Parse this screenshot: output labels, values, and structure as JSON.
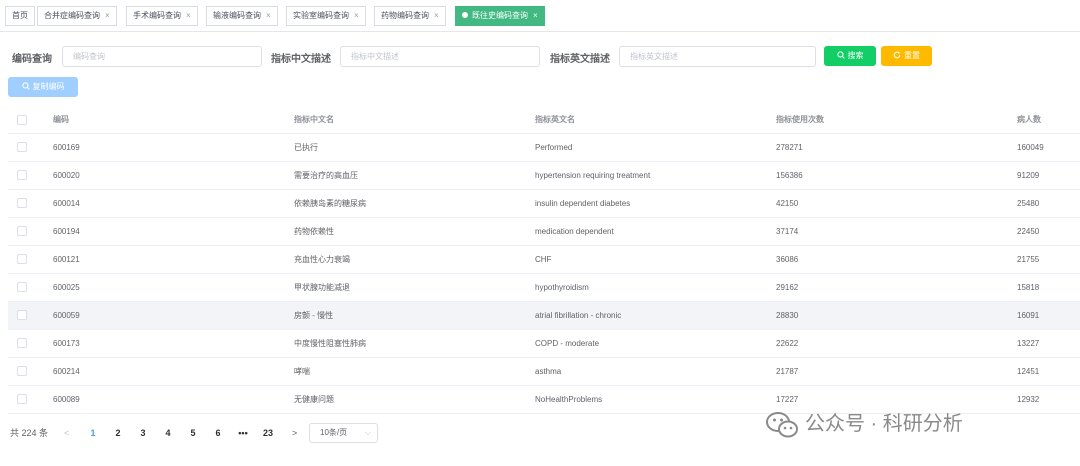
{
  "tags": [
    {
      "label": "首页",
      "closable": false,
      "active": false
    },
    {
      "label": "合并症编码查询",
      "closable": true,
      "active": false
    },
    {
      "label": "手术编码查询",
      "closable": true,
      "active": false
    },
    {
      "label": "输液编码查询",
      "closable": true,
      "active": false
    },
    {
      "label": "实验室编码查询",
      "closable": true,
      "active": false
    },
    {
      "label": "药物编码查询",
      "closable": true,
      "active": false
    },
    {
      "label": "既往史编码查询",
      "closable": true,
      "active": true
    }
  ],
  "close_glyph": "×",
  "filters": {
    "code_label": "编码查询",
    "code_placeholder": "编码查询",
    "cn_label": "指标中文描述",
    "cn_placeholder": "指标中文描述",
    "en_label": "指标英文描述",
    "en_placeholder": "指标英文描述"
  },
  "buttons": {
    "search": "搜索",
    "reset": "重置",
    "copy": "复制编码"
  },
  "table": {
    "columns": [
      "编码",
      "指标中文名",
      "指标英文名",
      "指标使用次数",
      "病人数"
    ],
    "rows": [
      [
        "600169",
        "已执行",
        "Performed",
        "278271",
        "160049"
      ],
      [
        "600020",
        "需要治疗的高血压",
        "hypertension requiring treatment",
        "156386",
        "91209"
      ],
      [
        "600014",
        "依赖胰岛素的糖尿病",
        "insulin dependent diabetes",
        "42150",
        "25480"
      ],
      [
        "600194",
        "药物依赖性",
        "medication dependent",
        "37174",
        "22450"
      ],
      [
        "600121",
        "充血性心力衰竭",
        "CHF",
        "36086",
        "21755"
      ],
      [
        "600025",
        "甲状腺功能减退",
        "hypothyroidism",
        "29162",
        "15818"
      ],
      [
        "600059",
        "房颤 - 慢性",
        "atrial fibrillation - chronic",
        "28830",
        "16091"
      ],
      [
        "600173",
        "中度慢性阻塞性肺病",
        "COPD - moderate",
        "22622",
        "13227"
      ],
      [
        "600214",
        "哮喘",
        "asthma",
        "21787",
        "12451"
      ],
      [
        "600089",
        "无健康问题",
        "NoHealthProblems",
        "17227",
        "12932"
      ]
    ],
    "highlighted_row": 6
  },
  "pagination": {
    "total_text": "共 224 条",
    "prev": "<",
    "pages": [
      "1",
      "2",
      "3",
      "4",
      "5",
      "6",
      "•••",
      "23"
    ],
    "current": "1",
    "next": ">",
    "page_size": "10条/页",
    "page_size_arrow": "⌵"
  },
  "watermark": {
    "text": "公众号 · 科研分析"
  },
  "colors": {
    "primary": "#409eff",
    "success": "#13ce66",
    "warning": "#ffba00",
    "active_tag": "#42b983",
    "copy_button": "#a0cfff"
  }
}
